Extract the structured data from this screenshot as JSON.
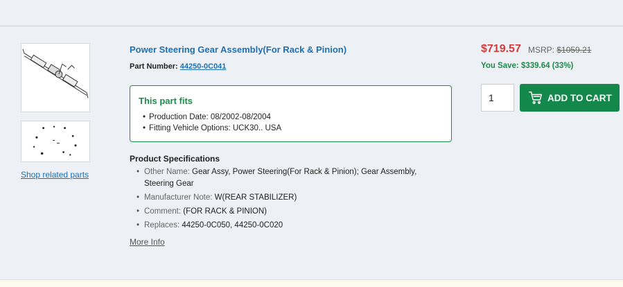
{
  "gallery": {
    "main_image_icon": "steering-rack-photo",
    "diagram_icon": "exploded-diagram-thumbnail",
    "related_link": "Shop related parts"
  },
  "product": {
    "title": "Power Steering Gear Assembly(For Rack & Pinion)",
    "part_number_label": "Part Number:",
    "part_number": "44250-0C041"
  },
  "fits": {
    "title": "This part fits",
    "items": [
      "Production Date: 08/2002-08/2004",
      "Fitting Vehicle Options: UCK30.. USA"
    ]
  },
  "specs": {
    "heading": "Product Specifications",
    "items": [
      {
        "key": "Other Name:",
        "value": "Gear Assy, Power Steering(For Rack & Pinion); Gear Assembly, Steering Gear"
      },
      {
        "key": "Manufacturer Note:",
        "value": "W(REAR STABILIZER)"
      },
      {
        "key": "Comment:",
        "value": "(FOR RACK & PINION)"
      },
      {
        "key": "Replaces:",
        "value": "44250-0C050, 44250-0C020"
      }
    ],
    "more_info": "More Info"
  },
  "pricing": {
    "price": "$719.57",
    "msrp_label": "MSRP:",
    "msrp": "$1059.21",
    "savings": "You Save: $339.64 (33%)"
  },
  "cart": {
    "quantity": "1",
    "button_label": "ADD TO CART",
    "icon": "cart-icon"
  },
  "colors": {
    "link": "#1f6fb2",
    "price": "#d63a3a",
    "green": "#1e8a4c",
    "button": "#14884a",
    "background": "#edf0f4"
  }
}
